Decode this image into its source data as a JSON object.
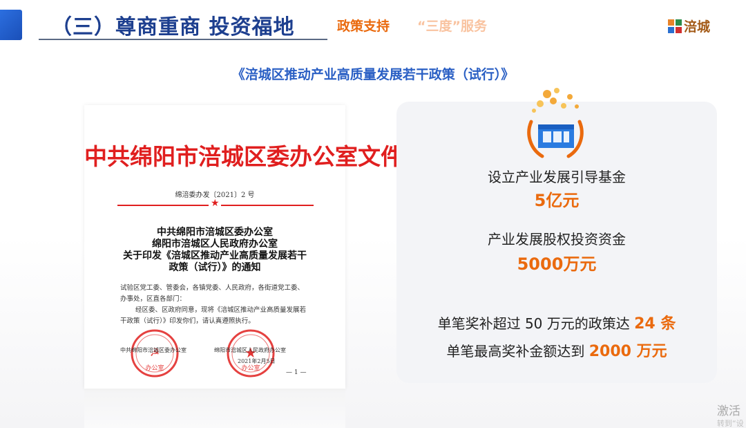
{
  "header": {
    "title": "（三）尊商重商  投资福地",
    "tag_policy": "政策支持",
    "tag_service": "“三度”服务",
    "logo_text": "涪城"
  },
  "subtitle": "《涪城区推动产业高质量发展若干政策（试行）》",
  "document": {
    "header": "中共绵阳市涪城区委办公室文件",
    "number": "绵涪委办发〔2021〕2 号",
    "title_line1": "中共绵阳市涪城区委办公室",
    "title_line2": "绵阳市涪城区人民政府办公室",
    "title_line3": "关于印发《涪城区推动产业高质量发展若干",
    "title_line4": "政策（试行）》的通知",
    "para_line1": "试验区党工委、管委会，各镇党委、人民政府，各街道党工委、",
    "para_line2": "办事处，区直各部门：",
    "para_line3": "经区委、区政府同意，现将《涪城区推动产业高质量发展若",
    "para_line4": "干政策（试行）》印发你们，请认真遵照执行。",
    "sign_left": "中共绵阳市涪城区委办公室",
    "sign_right": "绵阳市涪城区人民政府办公室",
    "date": "2021年2月5日",
    "page_mark": "— 1 —"
  },
  "stats": {
    "fund_label": "设立产业发展引导基金",
    "fund_value": "5亿元",
    "equity_label": "产业发展股权投资资金",
    "equity_value": "5000万元",
    "policy_prefix": "单笔奖补超过 50 万元的政策达",
    "policy_value": "24 条",
    "max_prefix": "单笔最高奖补金额达到",
    "max_value": "2000 万元"
  },
  "watermark": {
    "line1": "激活",
    "line2": "转到“设"
  },
  "colors": {
    "title_blue": "#1d3f8f",
    "accent_orange": "#ea6a0e",
    "subtitle_blue": "#2a5fc4",
    "doc_red": "#e01f1f"
  }
}
